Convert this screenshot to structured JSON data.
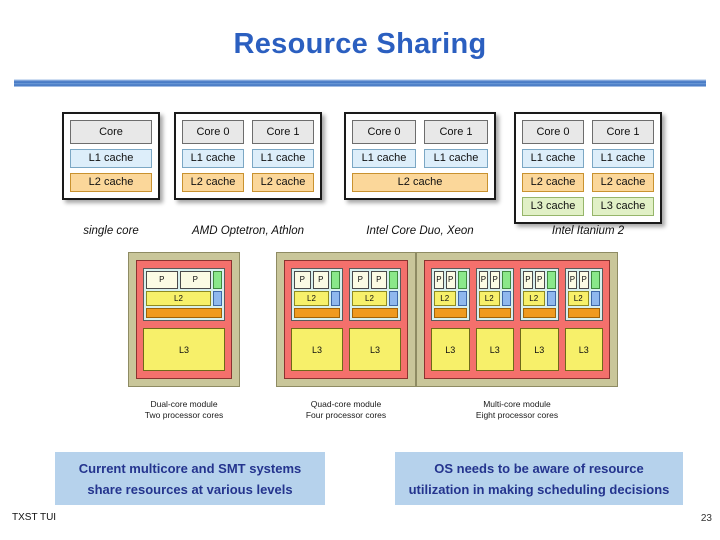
{
  "slide": {
    "title": "Resource Sharing",
    "page_number": "23",
    "footer": "TXST TUI"
  },
  "cache_diagrams": [
    {
      "caption": "single core",
      "columns": [
        {
          "core": "Core",
          "l1": "L1 cache",
          "l2": "L2 cache"
        }
      ],
      "shared_l2": null
    },
    {
      "caption": "AMD Optetron, Athlon",
      "columns": [
        {
          "core": "Core 0",
          "l1": "L1 cache",
          "l2": "L2 cache"
        },
        {
          "core": "Core 1",
          "l1": "L1 cache",
          "l2": "L2 cache"
        }
      ],
      "shared_l2": null
    },
    {
      "caption": "Intel Core Duo, Xeon",
      "columns": [
        {
          "core": "Core 0",
          "l1": "L1 cache"
        },
        {
          "core": "Core 1",
          "l1": "L1 cache"
        }
      ],
      "shared_l2": "L2 cache"
    },
    {
      "caption": "Intel Itanium 2",
      "columns": [
        {
          "core": "Core 0",
          "l1": "L1 cache",
          "l2": "L2 cache",
          "l3": "L3 cache"
        },
        {
          "core": "Core 1",
          "l1": "L1 cache",
          "l2": "L2 cache",
          "l3": "L3 cache"
        }
      ],
      "shared_l2": null
    }
  ],
  "module_diagrams": [
    {
      "caption_line1": "Dual-core module",
      "caption_line2": "Two processor cores",
      "core_units": 1,
      "l3_blocks": 1,
      "p_label": "P",
      "l2_label": "L2",
      "l3_label": "L3"
    },
    {
      "caption_line1": "Quad-core module",
      "caption_line2": "Four processor cores",
      "core_units": 2,
      "l3_blocks": 2,
      "p_label": "P",
      "l2_label": "L2",
      "l3_label": "L3"
    },
    {
      "caption_line1": "Multi-core module",
      "caption_line2": "Eight processor cores",
      "core_units": 4,
      "l3_blocks": 4,
      "p_label": "P",
      "l2_label": "L2",
      "l3_label": "L3"
    }
  ],
  "callouts": {
    "left": "Current multicore and SMT systems share resources at various levels",
    "right": "OS needs to be aware of resource utilization in making scheduling decisions"
  },
  "colors": {
    "title": "#2b5fc0",
    "core": "#e8e8e8",
    "l1": "#ddeefa",
    "l2": "#fbd79a",
    "l3": "#e1f0c6",
    "die": "#f4706c",
    "package": "#c9c69a",
    "callout_bg": "#b6d2ec",
    "callout_text": "#24348e"
  }
}
